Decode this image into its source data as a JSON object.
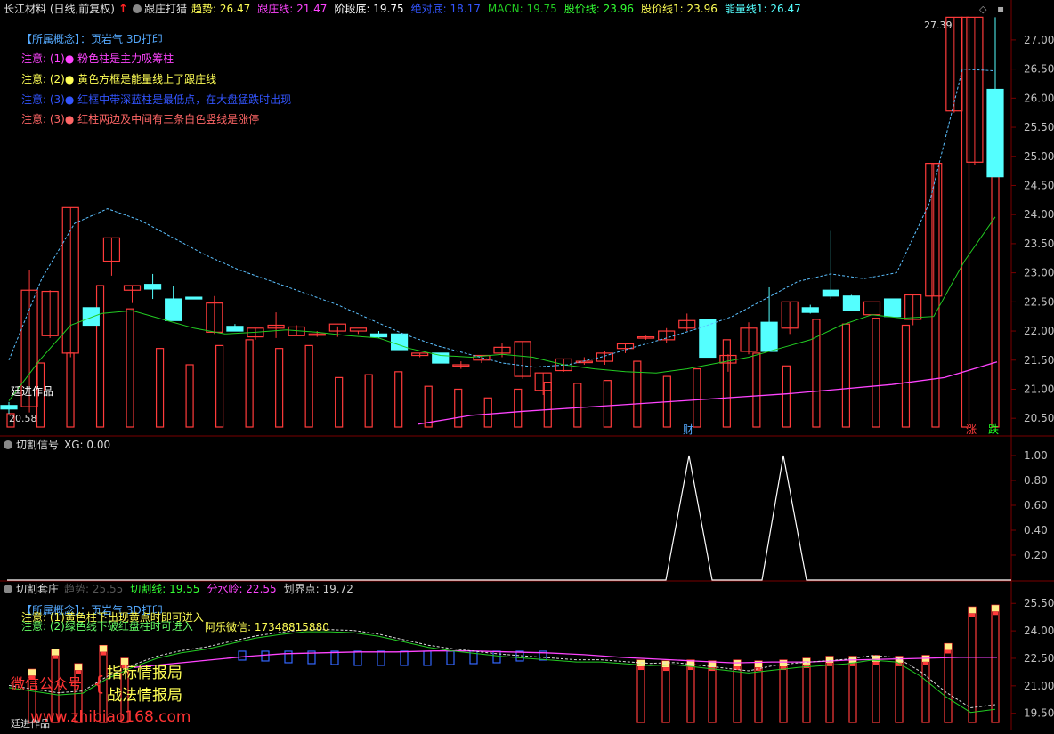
{
  "colors": {
    "bg": "#000000",
    "up": "#ff3b3b",
    "down": "#54ffff",
    "grid": "#7a0000",
    "axis_text": "#c0c0c0",
    "trend": "#5bc0ff",
    "banker": "#22cc22",
    "pink": "#ff44ff",
    "yellow": "#ffff00",
    "blue": "#3355ff",
    "white": "#ffffff"
  },
  "top_bar": {
    "stock": "长江材料 (日线,前复权)",
    "indicator": "跟庄打猎",
    "items": [
      {
        "label": "趋势:",
        "value": "26.47",
        "color": "#ffff55"
      },
      {
        "label": "跟庄线:",
        "value": "21.47",
        "color": "#ff44ff"
      },
      {
        "label": "阶段底:",
        "value": "19.75",
        "color": "#ffffff"
      },
      {
        "label": "绝对底:",
        "value": "18.17",
        "color": "#3355ff"
      },
      {
        "label": "MACN:",
        "value": "19.75",
        "color": "#22cc22"
      },
      {
        "label": "股价线:",
        "value": "23.96",
        "color": "#33ff33"
      },
      {
        "label": "股价线1:",
        "value": "23.96",
        "color": "#ffff55"
      },
      {
        "label": "能量线1:",
        "value": "26.47",
        "color": "#55ffff"
      }
    ]
  },
  "notes": {
    "concept": "【所属概念】：页岩气 3D打印",
    "n1": "注意: (1)●  粉色柱是主力吸筹柱",
    "n2": "注意: (2)●  黄色方框是能量线上了跟庄线",
    "n3": "注意: (3)●  红框中带深蓝柱是最低点，在大盘猛跌时出现",
    "n4": "注意: (3)●  红柱两边及中间有三条白色竖线是涨停"
  },
  "main_chart": {
    "type": "candlestick",
    "price_axis": [
      "27.00",
      "26.50",
      "26.00",
      "25.50",
      "25.00",
      "24.50",
      "24.00",
      "23.50",
      "23.00",
      "22.50",
      "22.00",
      "21.50",
      "21.00",
      "20.50"
    ],
    "y_range": [
      20.35,
      27.35
    ],
    "high_label": "27.39",
    "low_label": "20.58",
    "watermark": "廷进作品",
    "markers": {
      "cai": "财",
      "zhang": "涨",
      "die": "跌"
    },
    "candles": [
      [
        20.72,
        20.78,
        20.58,
        20.66
      ],
      [
        20.7,
        23.05,
        20.6,
        22.7
      ],
      [
        21.92,
        22.7,
        21.88,
        22.68
      ],
      [
        21.62,
        24.12,
        21.55,
        24.12
      ],
      [
        22.4,
        22.4,
        22.1,
        22.1
      ],
      [
        23.2,
        23.6,
        22.95,
        23.6
      ],
      [
        22.7,
        22.78,
        22.48,
        22.78
      ],
      [
        22.8,
        22.98,
        22.55,
        22.72
      ],
      [
        22.55,
        22.78,
        22.2,
        22.18
      ],
      [
        22.58,
        22.58,
        22.55,
        22.55
      ],
      [
        21.98,
        22.6,
        21.95,
        22.48
      ],
      [
        22.08,
        22.12,
        22.0,
        22.0
      ],
      [
        21.9,
        22.05,
        21.85,
        22.05
      ],
      [
        22.05,
        22.32,
        21.88,
        22.1
      ],
      [
        21.92,
        22.1,
        21.92,
        22.07
      ],
      [
        21.95,
        22.0,
        21.9,
        21.95
      ],
      [
        22.0,
        22.08,
        21.9,
        22.12
      ],
      [
        22.0,
        22.0,
        21.95,
        22.05
      ],
      [
        21.95,
        22.0,
        21.88,
        21.9
      ],
      [
        21.95,
        21.95,
        21.68,
        21.68
      ],
      [
        21.58,
        21.62,
        21.55,
        21.62
      ],
      [
        21.62,
        21.62,
        21.45,
        21.45
      ],
      [
        21.42,
        21.48,
        21.35,
        21.42
      ],
      [
        21.5,
        21.58,
        21.45,
        21.58
      ],
      [
        21.62,
        21.8,
        21.55,
        21.72
      ],
      [
        21.22,
        21.82,
        21.18,
        21.82
      ],
      [
        20.98,
        21.28,
        20.9,
        21.28
      ],
      [
        21.32,
        21.52,
        21.3,
        21.52
      ],
      [
        21.48,
        21.55,
        21.42,
        21.48
      ],
      [
        21.48,
        21.65,
        21.42,
        21.62
      ],
      [
        21.7,
        21.8,
        21.62,
        21.78
      ],
      [
        21.88,
        21.92,
        21.85,
        21.9
      ],
      [
        21.85,
        22.05,
        21.8,
        22.0
      ],
      [
        22.05,
        22.3,
        22.0,
        22.18
      ],
      [
        22.2,
        22.18,
        21.55,
        21.55
      ],
      [
        21.45,
        21.6,
        21.3,
        21.58
      ],
      [
        21.65,
        22.15,
        21.6,
        22.05
      ],
      [
        22.15,
        22.75,
        21.65,
        21.65
      ],
      [
        22.05,
        22.5,
        21.95,
        22.5
      ],
      [
        22.4,
        22.45,
        22.3,
        22.32
      ],
      [
        22.7,
        23.72,
        22.55,
        22.6
      ],
      [
        22.6,
        22.62,
        22.35,
        22.35
      ],
      [
        22.28,
        22.55,
        22.18,
        22.5
      ],
      [
        22.55,
        22.55,
        22.25,
        22.25
      ],
      [
        22.2,
        22.62,
        22.1,
        22.62
      ],
      [
        22.6,
        24.88,
        22.6,
        24.88
      ],
      [
        25.78,
        27.39,
        25.75,
        27.39
      ],
      [
        24.9,
        27.39,
        24.85,
        27.39
      ],
      [
        26.15,
        27.39,
        24.65,
        24.65
      ]
    ],
    "red_bars": [
      20.58,
      21.45,
      21.62,
      22.78,
      22.38,
      21.7,
      21.42,
      21.75,
      21.85,
      21.7,
      21.75,
      21.2,
      21.25,
      21.3,
      21.05,
      21.0,
      20.85,
      21.0,
      21.12,
      21.1,
      21.15,
      21.48,
      21.22,
      21.35,
      21.85,
      21.62,
      21.4,
      22.2,
      22.12,
      22.22,
      22.1,
      24.88,
      27.39,
      24.65
    ],
    "banker_line": [
      20.8,
      21.5,
      22.1,
      22.3,
      22.35,
      22.2,
      22.05,
      21.95,
      21.98,
      22.02,
      21.98,
      21.92,
      21.88,
      21.7,
      21.58,
      21.55,
      21.6,
      21.55,
      21.42,
      21.35,
      21.3,
      21.28,
      21.35,
      21.45,
      21.55,
      21.7,
      21.85,
      22.1,
      22.28,
      22.22,
      22.25,
      23.2,
      23.96
    ],
    "trend_line": [
      21.5,
      22.9,
      23.85,
      24.1,
      23.9,
      23.6,
      23.3,
      23.05,
      22.85,
      22.65,
      22.45,
      22.2,
      21.95,
      21.75,
      21.6,
      21.45,
      21.38,
      21.42,
      21.55,
      21.72,
      21.88,
      22.05,
      22.25,
      22.55,
      22.85,
      22.98,
      22.9,
      23.0,
      24.2,
      26.5,
      26.47
    ],
    "pink_line": [
      20.4,
      20.55,
      20.62,
      20.68,
      20.74,
      20.8,
      20.86,
      20.92,
      21.0,
      21.08,
      21.2,
      21.47
    ]
  },
  "panel2": {
    "title": "切割信号",
    "xg_label": "XG: 0.00",
    "axis": [
      "1.00",
      "0.80",
      "0.60",
      "0.40",
      "0.20"
    ],
    "signal_peaks": [
      {
        "at": 26,
        "value": 1.0
      },
      {
        "at": 30,
        "value": 1.0
      }
    ]
  },
  "panel3": {
    "title": "切割套庄",
    "items": [
      {
        "label": "趋势:",
        "value": "25.55",
        "color": "#555555"
      },
      {
        "label": "切割线:",
        "value": "19.55",
        "color": "#33ff33"
      },
      {
        "label": "分水岭:",
        "value": "22.55",
        "color": "#ff44ff"
      },
      {
        "label": "划界点:",
        "value": "19.72",
        "color": "#cccccc"
      }
    ],
    "axis": [
      "25.50",
      "24.00",
      "22.50",
      "21.00",
      "19.50"
    ],
    "y_range": [
      19.0,
      25.9
    ],
    "concept": "【所属概念】：页岩气 3D打印",
    "n1": "注意: (1)黄色柱下出现黄点时即可进入",
    "n2": "注意: (2)绿色线下破红盘柱时可进入",
    "contact": "阿乐微信: 17348815880",
    "overlay_left": "微信公众号",
    "overlay_r1": "指标情报局",
    "overlay_r2": "战法情报局",
    "url": "www.zhibiao168.com",
    "watermark": "廷进作品",
    "cut_line": [
      20.9,
      20.7,
      20.5,
      20.6,
      21.4,
      22.0,
      22.5,
      22.8,
      23.0,
      23.3,
      23.6,
      23.8,
      23.95,
      23.95,
      23.9,
      23.7,
      23.4,
      23.1,
      22.9,
      22.75,
      22.6,
      22.5,
      22.4,
      22.3,
      22.3,
      22.2,
      22.1,
      22.15,
      22.0,
      21.85,
      21.7,
      21.85,
      22.0,
      22.1,
      22.2,
      22.4,
      22.3,
      21.5,
      20.4,
      19.55,
      19.72
    ],
    "divide_line": [
      22.0,
      22.2,
      22.4,
      22.6,
      22.75,
      22.8,
      22.85,
      22.85,
      22.9,
      22.9,
      22.85,
      22.8,
      22.7,
      22.55,
      22.45,
      22.35,
      22.25,
      22.3,
      22.3,
      22.4,
      22.45,
      22.5,
      22.55,
      22.55
    ]
  }
}
